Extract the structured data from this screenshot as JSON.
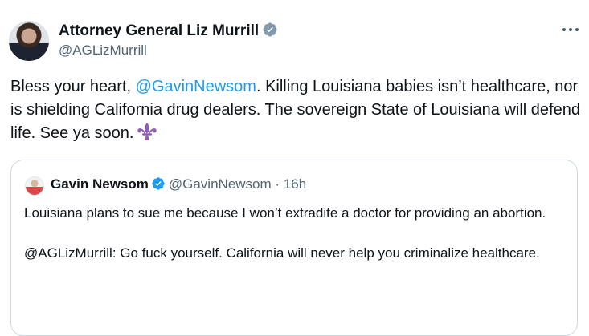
{
  "author": {
    "name": "Attorney General Liz Murrill",
    "handle": "@AGLizMurrill",
    "verified_color": "#829aab"
  },
  "more_icon": "more-horizontal-icon",
  "tweet": {
    "text_prefix": "Bless your heart, ",
    "mention": "@GavinNewsom",
    "text_suffix": ". Killing Louisiana babies isn’t healthcare, nor is shielding California drug dealers. The sovereign State of Louisiana will defend life. See ya soon.",
    "emoji": "fleur-de-lis",
    "emoji_color": "#8e5db5"
  },
  "quoted": {
    "name": "Gavin Newsom",
    "handle": "@GavinNewsom",
    "separator": "·",
    "time": "16h",
    "verified_color": "#1d9bf0",
    "paragraph1": "Louisiana plans to sue me because I won’t extradite a doctor for providing an abortion.",
    "paragraph2": "@AGLizMurrill: Go fuck yourself. California will never help you criminalize healthcare."
  },
  "colors": {
    "link": "#1d9bf0",
    "secondary_text": "#536471",
    "border": "#cfd9de"
  }
}
